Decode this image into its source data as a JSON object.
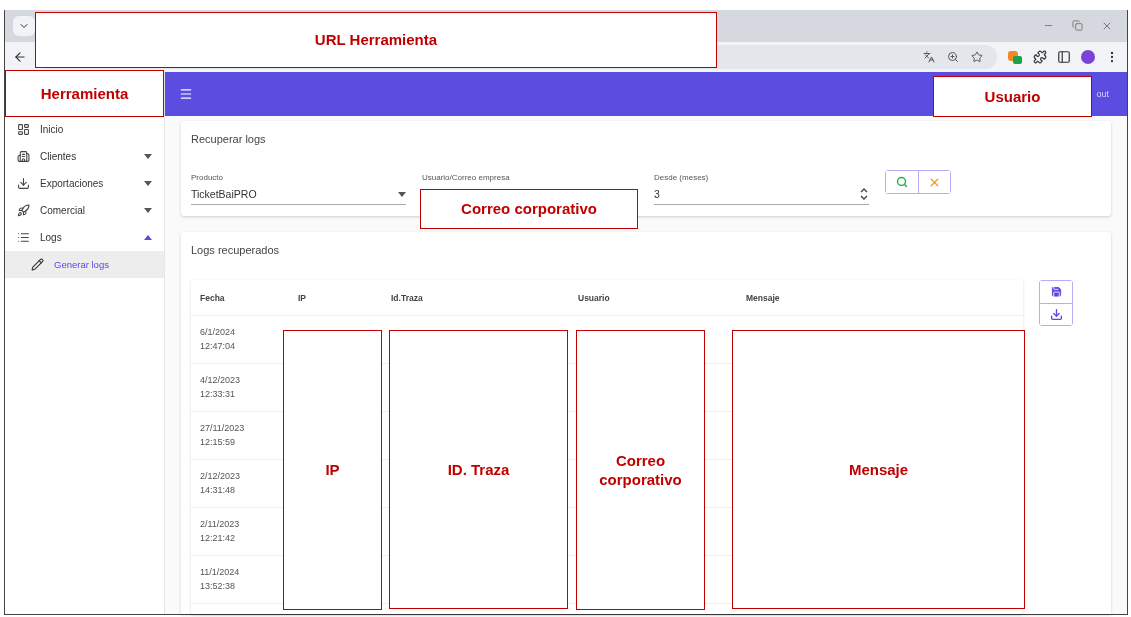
{
  "app_bar": {
    "user_text": "out"
  },
  "sidebar": {
    "items": [
      {
        "label": "Inicio",
        "selected": false
      },
      {
        "label": "Clientes",
        "expanded": false,
        "selected": false
      },
      {
        "label": "Exportaciones",
        "expanded": false,
        "selected": false
      },
      {
        "label": "Comercial",
        "expanded": false,
        "selected": false
      },
      {
        "label": "Logs",
        "expanded": true,
        "selected": false,
        "children": [
          {
            "label": "Generar logs",
            "selected": true
          }
        ]
      }
    ]
  },
  "search_card": {
    "title": "Recuperar logs",
    "fields": [
      {
        "kind": "select",
        "label": "Producto",
        "value": "TicketBaiPRO"
      },
      {
        "kind": "text",
        "label": "Usuario/Correo empresa"
      },
      {
        "kind": "number",
        "label": "Desde (meses)",
        "value": "3"
      }
    ]
  },
  "results_card": {
    "title": "Logs recuperados",
    "table": {
      "columns": [
        "Fecha",
        "IP",
        "Id.Traza",
        "Usuario",
        "Mensaje"
      ],
      "rows": [
        {
          "date": "6/1/2024",
          "time": "12:47:04"
        },
        {
          "date": "4/12/2023",
          "time": "12:33:31"
        },
        {
          "date": "27/11/2023",
          "time": "12:15:59"
        },
        {
          "date": "2/12/2023",
          "time": "14:31:48"
        },
        {
          "date": "2/11/2023",
          "time": "12:21:42"
        },
        {
          "date": "11/1/2024",
          "time": "13:52:38"
        }
      ]
    }
  },
  "annotations": [
    {
      "label": "URL Herramienta"
    },
    {
      "label": "Herramienta"
    },
    {
      "label": "Usuario"
    },
    {
      "label": "Correo corporativo"
    },
    {
      "label": "IP"
    },
    {
      "label": "ID. Traza"
    },
    {
      "label": "Correo corporativo"
    },
    {
      "label": "Mensaje"
    }
  ]
}
